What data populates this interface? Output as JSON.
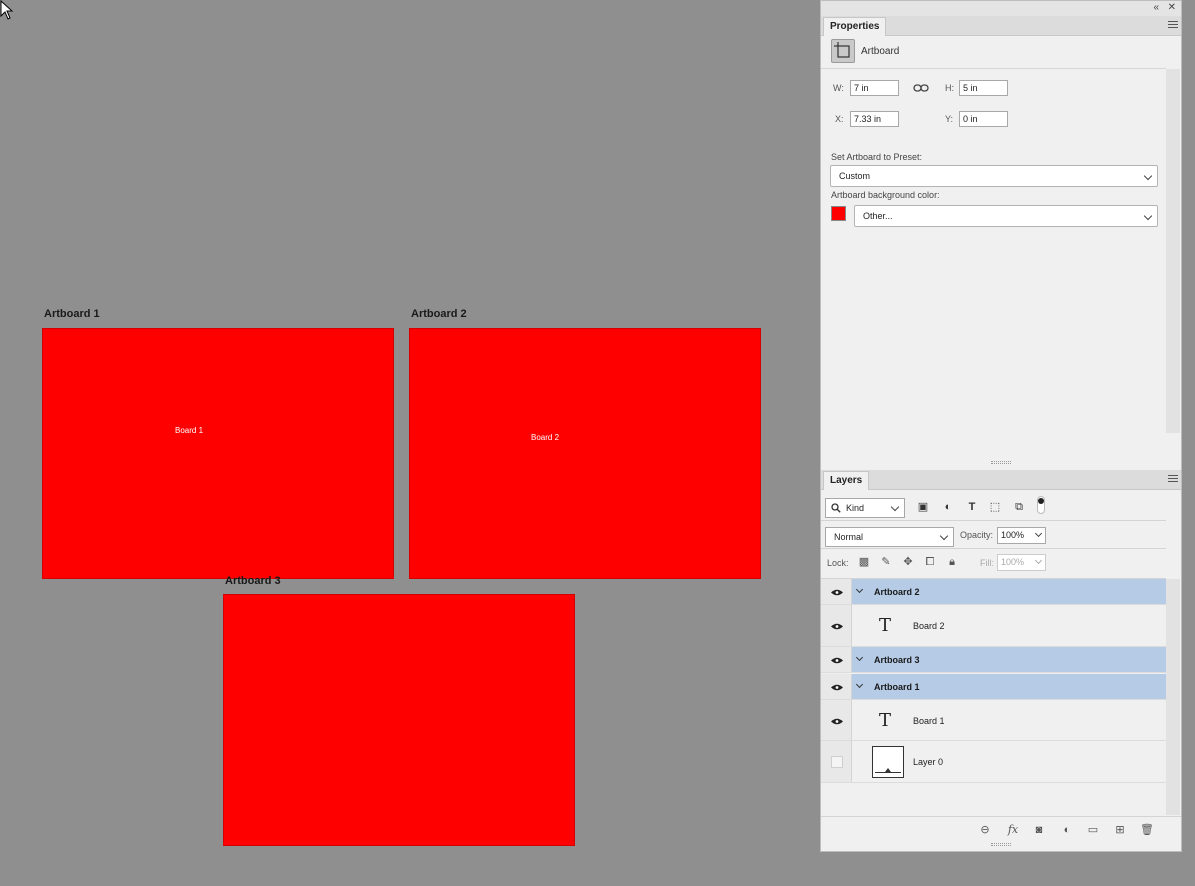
{
  "canvas": {
    "background_color": "#8f8f8f",
    "artboards": [
      {
        "label": "Artboard 1",
        "text": "Board 1",
        "fill": "#ff0000"
      },
      {
        "label": "Artboard 2",
        "text": "Board 2",
        "fill": "#ff0000"
      },
      {
        "label": "Artboard 3",
        "text": "",
        "fill": "#ff0000"
      }
    ]
  },
  "properties": {
    "tab_label": "Properties",
    "kind_label": "Artboard",
    "kind_icon": "artboard-icon",
    "w_label": "W:",
    "w_value": "7 in",
    "h_label": "H:",
    "h_value": "5 in",
    "x_label": "X:",
    "x_value": "7.33 in",
    "y_label": "Y:",
    "y_value": "0 in",
    "preset_label": "Set Artboard to Preset:",
    "preset_value": "Custom",
    "bg_label": "Artboard background color:",
    "bg_value": "Other...",
    "bg_color": "#ff0000"
  },
  "layers": {
    "tab_label": "Layers",
    "filter_kind": "Kind",
    "filter_icons": [
      "image-filter-icon",
      "adjustment-filter-icon",
      "type-filter-icon",
      "shape-filter-icon",
      "smart-object-filter-icon"
    ],
    "blend_mode": "Normal",
    "opacity_label": "Opacity:",
    "opacity_value": "100%",
    "lock_label": "Lock:",
    "lock_icons": [
      "lock-transparent-icon",
      "lock-paint-icon",
      "lock-position-icon",
      "lock-artboard-icon",
      "lock-all-icon"
    ],
    "fill_label": "Fill:",
    "fill_value": "100%",
    "rows": [
      {
        "name": "Artboard 2",
        "type": "group",
        "visible": true
      },
      {
        "name": "Board 2",
        "type": "text",
        "visible": true
      },
      {
        "name": "Artboard 3",
        "type": "group",
        "visible": true
      },
      {
        "name": "Artboard 1",
        "type": "group",
        "visible": true
      },
      {
        "name": "Board 1",
        "type": "text",
        "visible": true
      },
      {
        "name": "Layer 0",
        "type": "pixel",
        "visible": false
      }
    ],
    "bottom_icons": [
      "link-layers-icon",
      "fx-icon",
      "add-mask-icon",
      "new-adjustment-icon",
      "new-group-icon",
      "new-layer-icon",
      "delete-icon"
    ],
    "selection_color": "#b5cbe6"
  }
}
